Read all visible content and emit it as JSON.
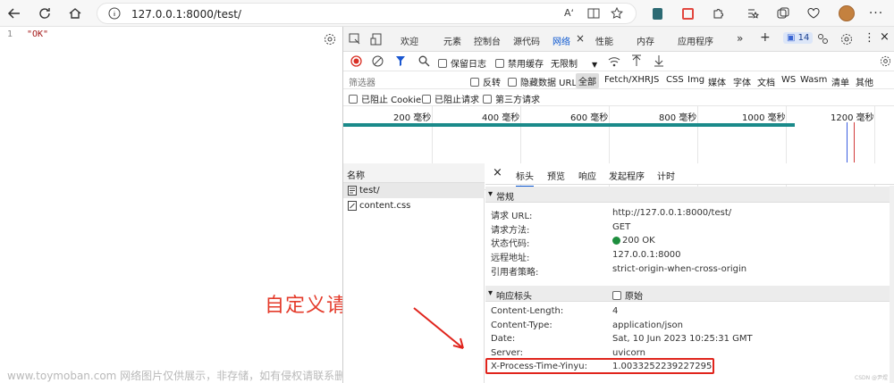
{
  "browser": {
    "url": "127.0.0.1:8000/test/",
    "read_aloud_label": "Aʻ"
  },
  "page": {
    "line_number": "1",
    "json_text": "\"OK\""
  },
  "devtools": {
    "tabs": [
      "欢迎",
      "元素",
      "控制台",
      "源代码",
      "网络",
      "性能",
      "内存",
      "应用程序"
    ],
    "issues_badge": "14",
    "preserve_log": "保留日志",
    "disable_cache": "禁用缓存",
    "throttle": "无限制",
    "filter_placeholder": "筛选器",
    "invert": "反转",
    "hide_data_url": "隐藏数据 URL",
    "filter_types": [
      "全部",
      "Fetch/XHR",
      "JS",
      "CSS",
      "Img",
      "媒体",
      "字体",
      "文档",
      "WS",
      "Wasm",
      "清单",
      "其他"
    ],
    "blocked_cookie": "已阻止 Cookie",
    "blocked_requests": "已阻止请求",
    "third_party": "第三方请求",
    "timeline_ticks": [
      "200 毫秒",
      "400 毫秒",
      "600 毫秒",
      "800 毫秒",
      "1000 毫秒",
      "1200 毫秒"
    ],
    "name_header": "名称",
    "requests": [
      {
        "name": "test/",
        "icon": "document-icon"
      },
      {
        "name": "content.css",
        "icon": "stylesheet-icon"
      }
    ],
    "detail_tabs": [
      "标头",
      "预览",
      "响应",
      "发起程序",
      "计时"
    ],
    "general_title": "常规",
    "general": [
      {
        "k": "请求 URL:",
        "v": "http://127.0.0.1:8000/test/"
      },
      {
        "k": "请求方法:",
        "v": "GET"
      },
      {
        "k": "状态代码:",
        "v": "200 OK"
      },
      {
        "k": "远程地址:",
        "v": "127.0.0.1:8000"
      },
      {
        "k": "引用者策略:",
        "v": "strict-origin-when-cross-origin"
      }
    ],
    "response_title": "响应标头",
    "raw_label": "原始",
    "response_headers": [
      {
        "k": "Content-Length:",
        "v": "4"
      },
      {
        "k": "Content-Type:",
        "v": "application/json"
      },
      {
        "k": "Date:",
        "v": "Sat, 10 Jun 2023 10:25:31 GMT"
      },
      {
        "k": "Server:",
        "v": "uvicorn"
      },
      {
        "k": "X-Process-Time-Yinyu:",
        "v": "1.0033252239227295"
      }
    ]
  },
  "annotation": "自定义请求头",
  "watermark": "www.toymoban.com 网络图片仅供展示，非存储，如有侵权请联系删除。",
  "csdn_mark": "CSDN @尹煜",
  "colors": {
    "accent": "#0b57d0",
    "annotation": "#e43b2b",
    "status_ok": "#1e8e3e"
  }
}
